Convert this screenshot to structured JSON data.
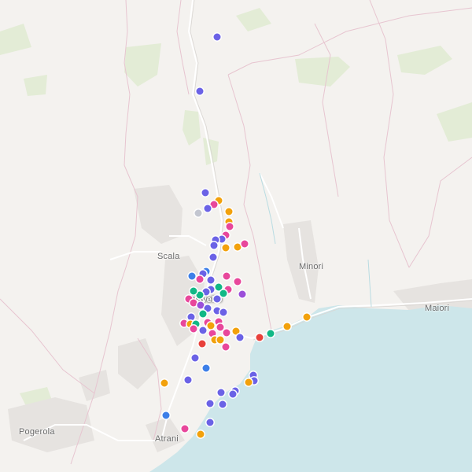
{
  "map": {
    "place_labels": {
      "ravello": "Ravello",
      "scala": "Scala",
      "minori": "Minori",
      "maiori": "Maiori",
      "pogerola": "Pogerola",
      "atrani": "Atrani"
    },
    "marker_colors": {
      "indigo": "#6b62e6",
      "pink": "#e8479b",
      "orange": "#f2a10c",
      "green": "#12b886",
      "red": "#e8403a",
      "blue": "#3d7fe8",
      "purple": "#9b4fd9",
      "gray": "#c3c6d0"
    },
    "sea_color": "#cde6ea",
    "land_color": "#f4f2ef"
  }
}
